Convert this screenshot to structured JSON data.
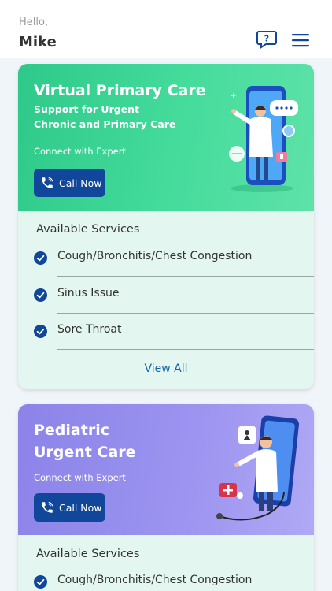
{
  "header": {
    "greeting": "Hello,",
    "username": "Mike"
  },
  "cards": [
    {
      "title": "Virtual Primary Care",
      "subtitle_line1": "Support for Urgent",
      "subtitle_line2": "Chronic and Primary Care",
      "connect": "Connect with Expert",
      "call_label": "Call Now",
      "services_title": "Available Services",
      "services": [
        "Cough/Bronchitis/Chest Congestion",
        "Sinus Issue",
        "Sore Throat"
      ],
      "view_all": "View All",
      "banner_color": "#3fd596"
    },
    {
      "title_line1": "Pediatric",
      "title_line2": "Urgent Care",
      "connect": "Connect with Expert",
      "call_label": "Call Now",
      "services_title": "Available Services",
      "services": [
        "Cough/Bronchitis/Chest Congestion"
      ],
      "banner_color": "#978ff0"
    }
  ],
  "colors": {
    "call_button": "#11479a",
    "check": "#11479a",
    "link": "#1565a8"
  },
  "icons": [
    "help-chat-icon",
    "hamburger-menu-icon",
    "phone-icon",
    "check-circle-icon"
  ]
}
